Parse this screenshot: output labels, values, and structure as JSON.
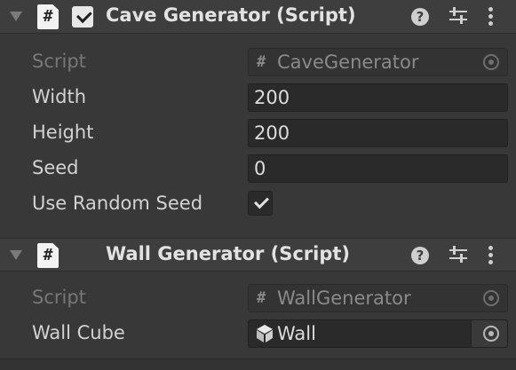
{
  "components": [
    {
      "title": "Cave Generator (Script)",
      "has_enable_toggle": true,
      "enabled": true,
      "properties": {
        "script": {
          "label": "Script",
          "value": "CaveGenerator"
        },
        "width": {
          "label": "Width",
          "value": "200"
        },
        "height": {
          "label": "Height",
          "value": "200"
        },
        "seed": {
          "label": "Seed",
          "value": "0"
        },
        "use_random_seed": {
          "label": "Use Random Seed",
          "checked": true
        }
      }
    },
    {
      "title": "Wall Generator (Script)",
      "has_enable_toggle": false,
      "properties": {
        "script": {
          "label": "Script",
          "value": "WallGenerator"
        },
        "wall_cube": {
          "label": "Wall Cube",
          "value": "Wall"
        }
      }
    }
  ],
  "icons": {
    "foldout": "triangle-down-icon",
    "script": "script-file-icon",
    "help": "help-icon",
    "presets": "presets-sliders-icon",
    "menu": "kebab-menu-icon",
    "object_picker": "object-picker-icon",
    "prefab": "prefab-cube-icon"
  },
  "glyphs": {
    "help": "?",
    "hash": "#"
  },
  "colors": {
    "background": "#383838",
    "header": "#3e3e3e",
    "field": "#2a2a2a",
    "text": "#d2d2d2",
    "disabled_text": "#777777"
  }
}
